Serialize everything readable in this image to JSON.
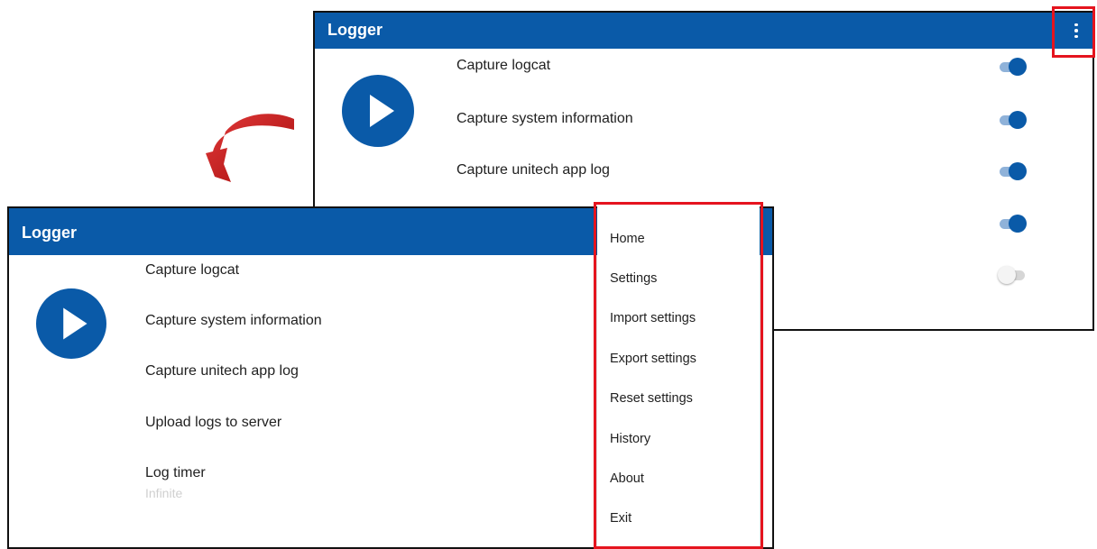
{
  "back_screen": {
    "title": "Logger",
    "toggles": [
      {
        "label": "Capture logcat",
        "state": "on"
      },
      {
        "label": "Capture system information",
        "state": "on"
      },
      {
        "label": "Capture unitech app log",
        "state": "on"
      },
      {
        "label": "",
        "state": "on"
      },
      {
        "label": "",
        "state": "off"
      }
    ]
  },
  "front_screen": {
    "title": "Logger",
    "items": [
      {
        "label": "Capture logcat"
      },
      {
        "label": "Capture system information"
      },
      {
        "label": "Capture unitech app log"
      },
      {
        "label": "Upload logs to server"
      },
      {
        "label": "Log timer",
        "sublabel": "Infinite"
      }
    ],
    "menu": [
      "Home",
      "Settings",
      "Import settings",
      "Export settings",
      "Reset settings",
      "History",
      "About",
      "Exit"
    ]
  },
  "colors": {
    "app_bar": "#0a5aa8",
    "highlight": "#e5141e",
    "arrow": "#cc1515"
  },
  "icons": {
    "overflow": "more-vert-icon",
    "start": "play-icon",
    "transition": "curved-arrow-icon"
  }
}
